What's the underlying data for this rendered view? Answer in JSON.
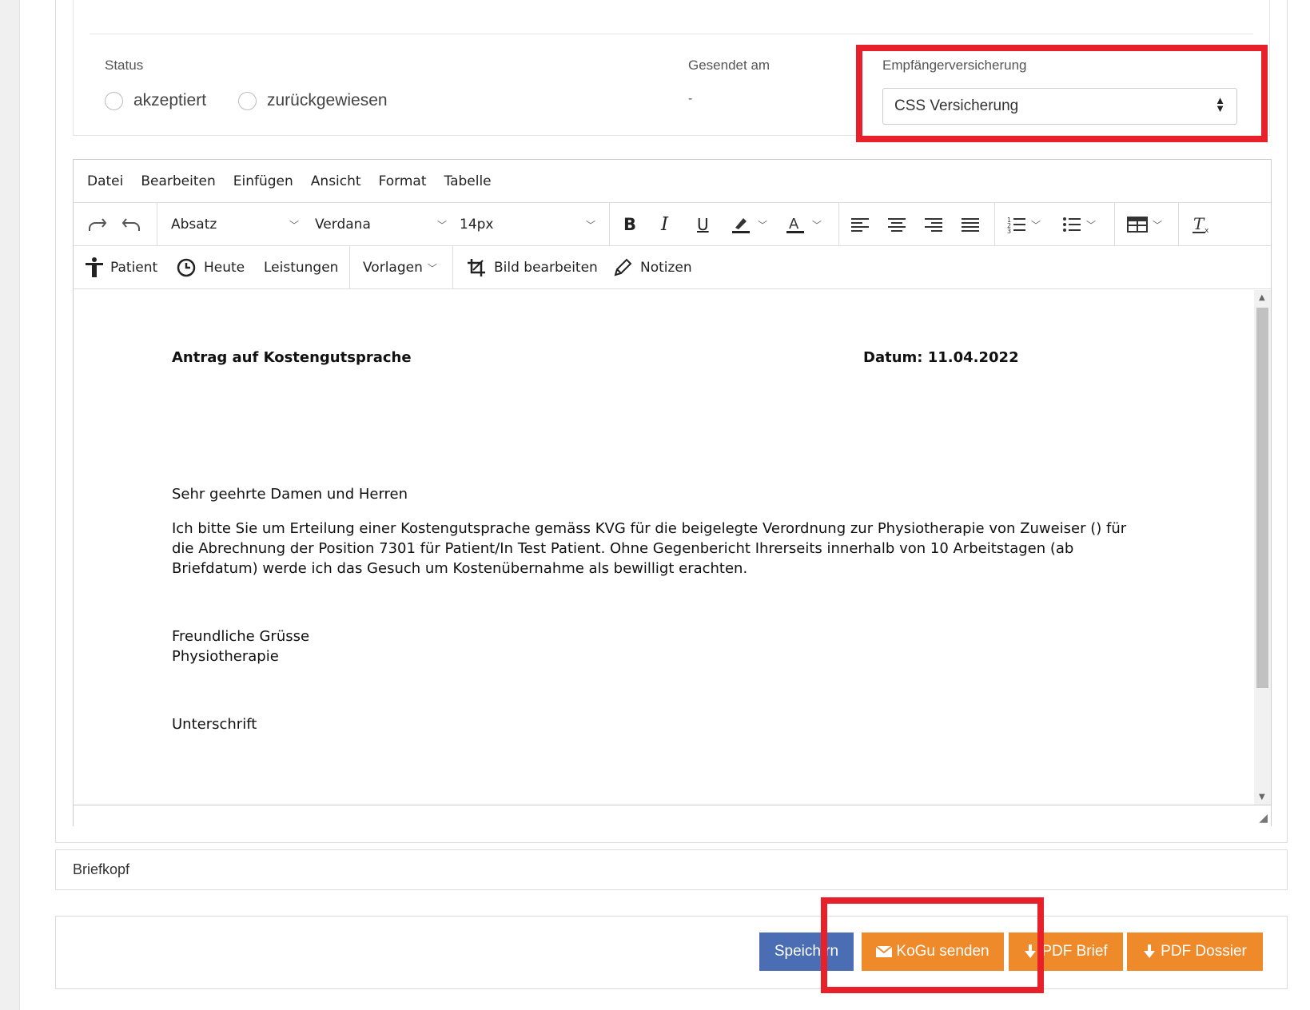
{
  "status_section": {
    "status_label": "Status",
    "radio_accepted": "akzeptiert",
    "radio_rejected": "zurückgewiesen",
    "sent_label": "Gesendet am",
    "sent_value": "-",
    "insurance_label": "Empfängerversicherung",
    "insurance_value": "CSS Versicherung"
  },
  "menubar": {
    "file": "Datei",
    "edit": "Bearbeiten",
    "insert": "Einfügen",
    "view": "Ansicht",
    "format": "Format",
    "table": "Tabelle"
  },
  "toolbar": {
    "block_format": "Absatz",
    "font_family": "Verdana",
    "font_size": "14px",
    "bold": "B",
    "italic": "I",
    "underline": "U",
    "patient": "Patient",
    "today": "Heute",
    "services": "Leistungen",
    "templates": "Vorlagen",
    "edit_image": "Bild bearbeiten",
    "notes": "Notizen"
  },
  "document": {
    "title": "Antrag auf Kostengutsprache",
    "date": "Datum: 11.04.2022",
    "salutation": "Sehr geehrte Damen und Herren",
    "body_line1": "Ich bitte Sie um Erteilung einer Kostengutsprache gemäss KVG für die beigelegte Verordnung zur Physiotherapie von Zuweiser () für",
    "body_line2": "die Abrechnung der Position 7301 für Patient/In Test Patient. Ohne Gegenbericht Ihrerseits innerhalb von 10 Arbeitstagen (ab",
    "body_line3": "Briefdatum) werde ich das Gesuch um Kostenübernahme als bewilligt erachten.",
    "closing1": "Freundliche Grüsse",
    "closing2": "Physiotherapie",
    "signature": "Unterschrift"
  },
  "briefkopf": "Briefkopf",
  "buttons": {
    "save": "Speich   rn",
    "send_kogu": "KoGu senden",
    "pdf_letter": "PDF Brief",
    "pdf_dossier": "PDF Dossier"
  },
  "colors": {
    "highlight_red": "#e8202a",
    "primary_blue": "#4a6db3",
    "accent_orange": "#ef8a2a"
  }
}
